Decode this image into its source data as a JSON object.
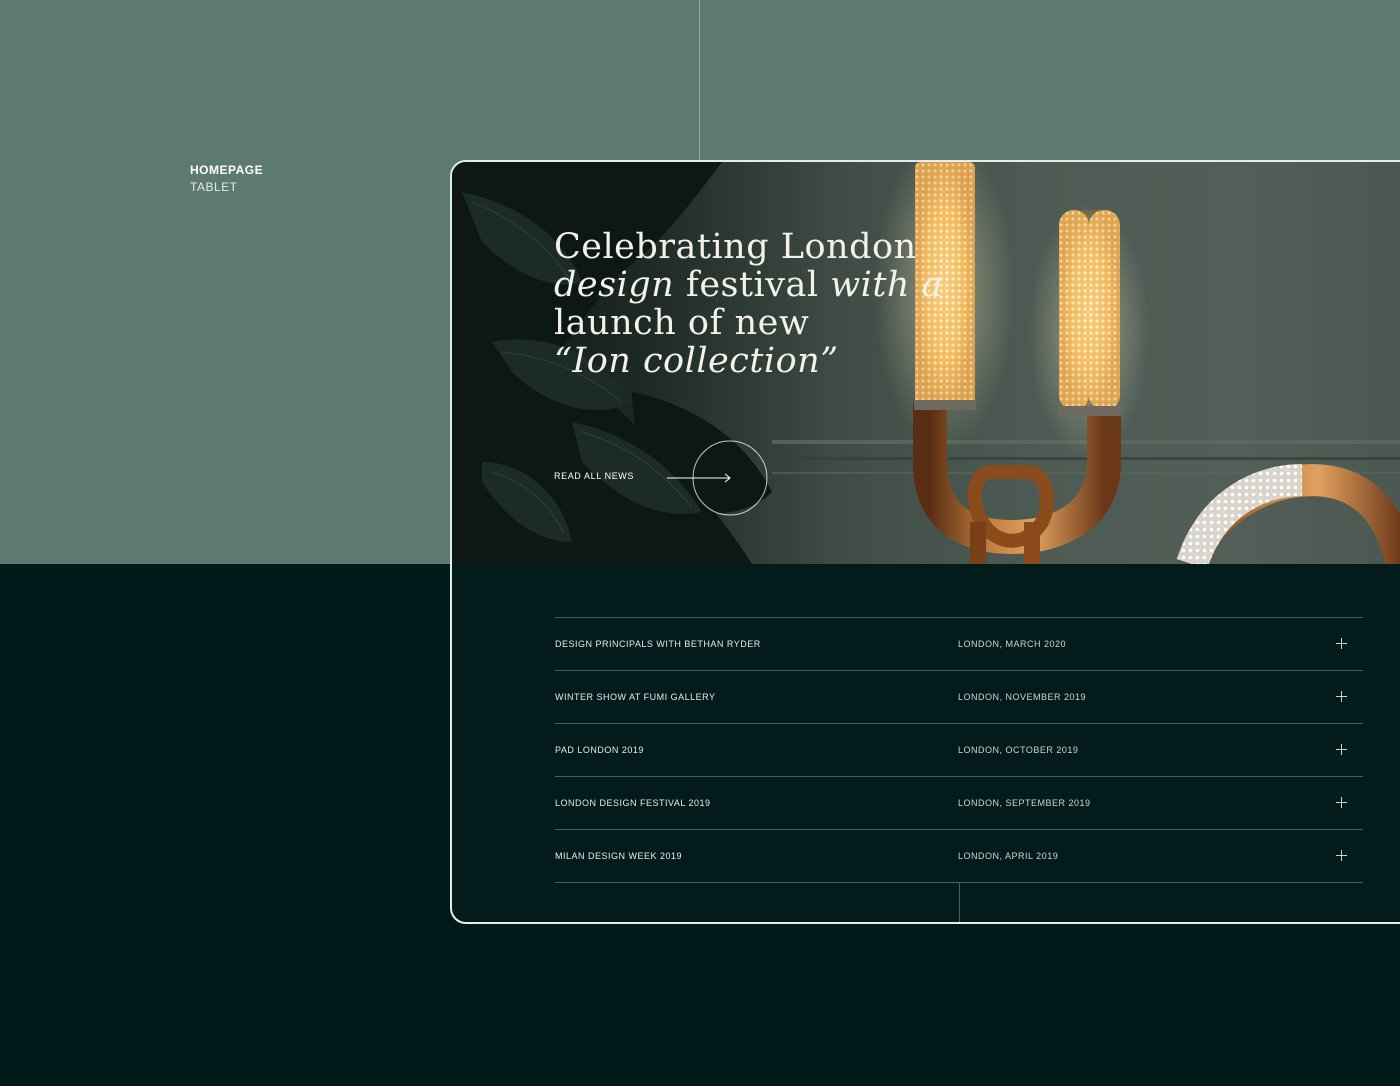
{
  "label": {
    "title": "HOMEPAGE",
    "subtitle": "TABLET"
  },
  "hero": {
    "headline_line1": "Celebrating London",
    "headline_line2_a": "design",
    "headline_line2_b": " festival ",
    "headline_line2_c": "with a",
    "headline_line3": "launch of new",
    "headline_line4": "“Ion collection”",
    "cta_label": "READ ALL NEWS"
  },
  "news": [
    {
      "name": "DESIGN PRINCIPALS WITH BETHAN RYDER",
      "date": "LONDON, MARCH 2020"
    },
    {
      "name": "WINTER SHOW AT FUMI GALLERY",
      "date": "LONDON, NOVEMBER 2019"
    },
    {
      "name": "PAD LONDON 2019",
      "date": "LONDON, OCTOBER 2019"
    },
    {
      "name": "LONDON DESIGN FESTIVAL 2019",
      "date": "LONDON, SEPTEMBER 2019"
    },
    {
      "name": "MILAN DESIGN WEEK 2019",
      "date": "LONDON, APRIL 2019"
    }
  ],
  "colors": {
    "sage_background": "#5d7a72",
    "dark_background": "#021a1a",
    "copper": "#b9743a",
    "glow": "#ffd57a"
  },
  "icons": {
    "arrow": "arrow-right-circle-icon",
    "expand": "plus-icon"
  }
}
